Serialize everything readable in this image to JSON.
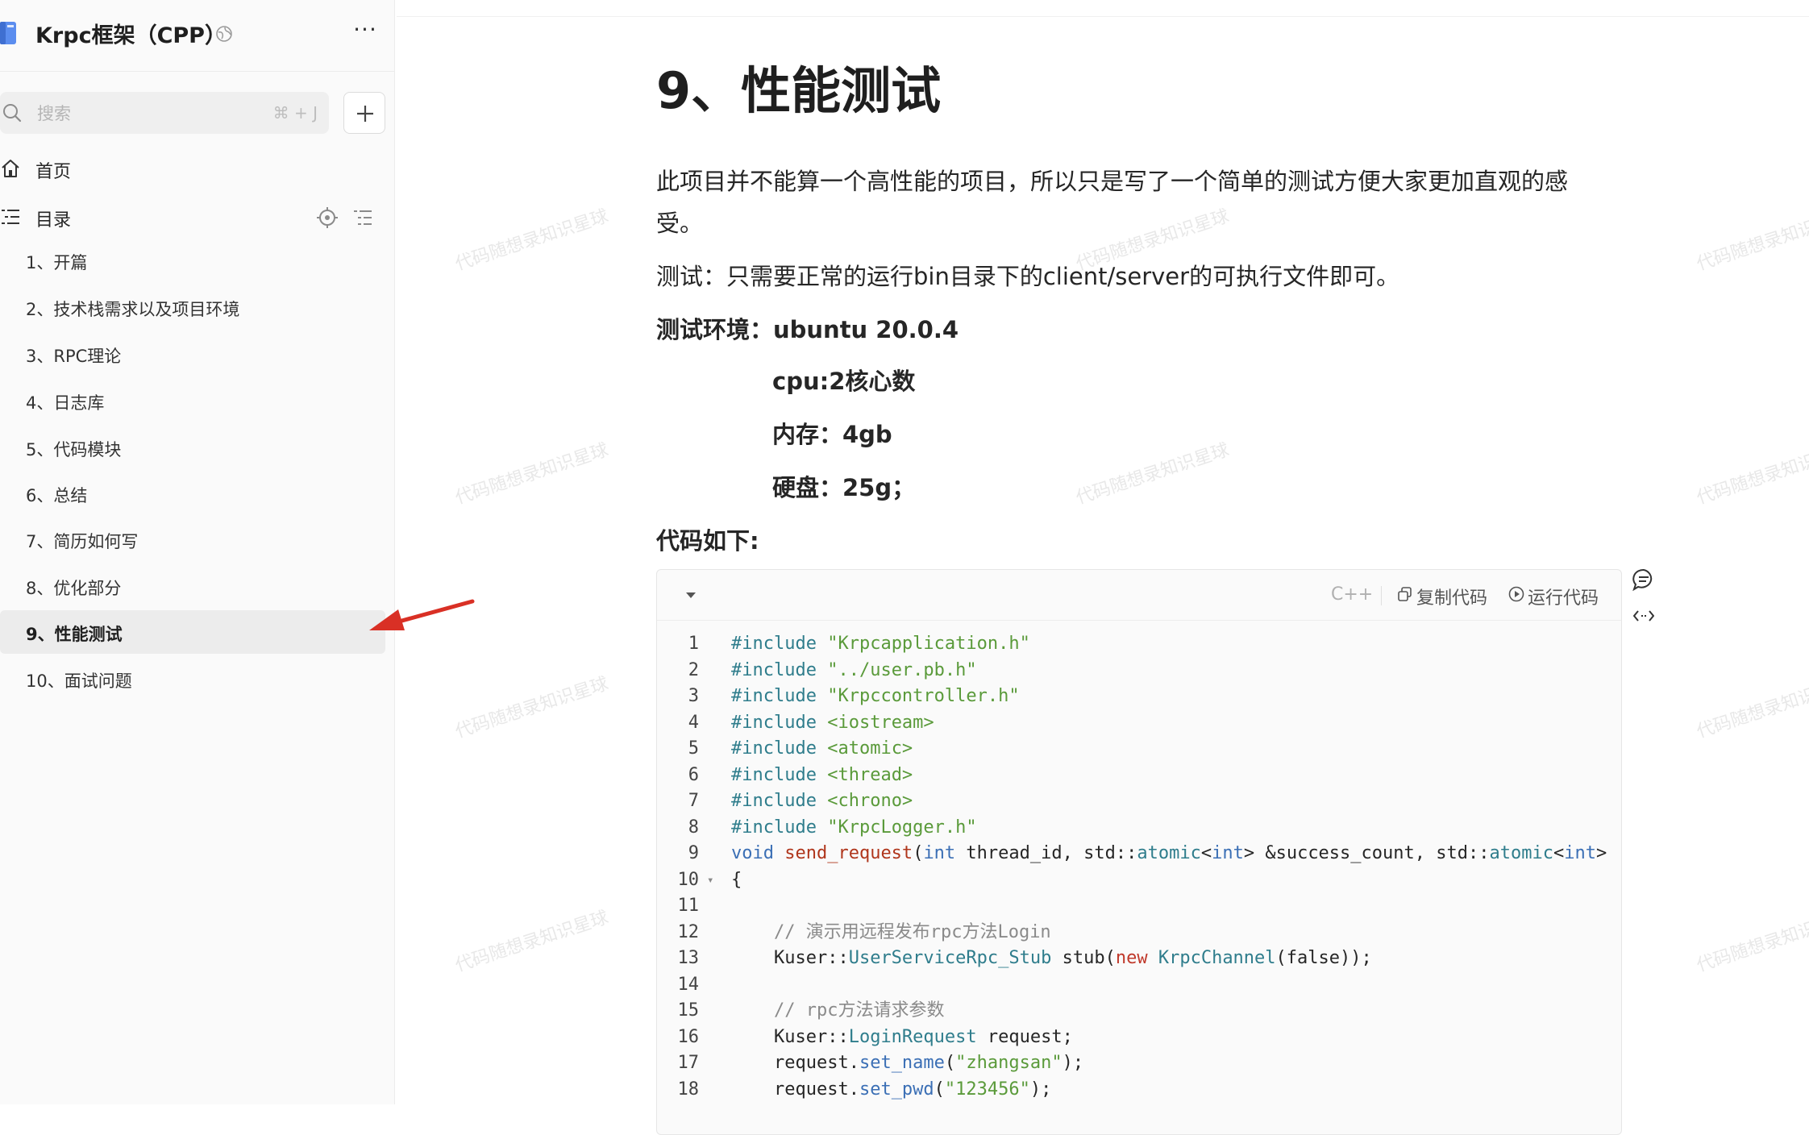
{
  "sidebar": {
    "book_title": "Krpc框架（CPP）",
    "search": {
      "placeholder": "搜索",
      "shortcut": "⌘ + J"
    },
    "nav": {
      "home": "首页",
      "toc": "目录"
    },
    "toc_items": [
      "1、开篇",
      "2、技术栈需求以及项目环境",
      "3、RPC理论",
      "4、日志库",
      "5、代码模块",
      "6、总结",
      "7、简历如何写",
      "8、优化部分",
      "9、性能测试",
      "10、面试问题"
    ],
    "active_index": 8
  },
  "doc": {
    "title": "9、性能测试",
    "para1_line1": "此项目并不能算一个高性能的项目，所以只是写了一个简单的测试方便大家更加直观的感",
    "para1_line2": "受。",
    "para2": "测试：只需要正常的运行bin目录下的client/server的可执行文件即可。",
    "env_line": "测试环境：ubuntu 20.0.4",
    "cpu_line": "cpu:2核心数",
    "mem_line": "内存：4gb",
    "disk_line": "硬盘：25g；",
    "code_heading": "代码如下:"
  },
  "code_block": {
    "language": "C++",
    "copy_label": "复制代码",
    "run_label": "运行代码",
    "lines": [
      {
        "n": "1",
        "fold": false,
        "tokens": [
          [
            "pre",
            "#include "
          ],
          [
            "str",
            "\"Krpcapplication.h\""
          ]
        ]
      },
      {
        "n": "2",
        "fold": false,
        "tokens": [
          [
            "pre",
            "#include "
          ],
          [
            "str",
            "\"../user.pb.h\""
          ]
        ]
      },
      {
        "n": "3",
        "fold": false,
        "tokens": [
          [
            "pre",
            "#include "
          ],
          [
            "str",
            "\"Krpccontroller.h\""
          ]
        ]
      },
      {
        "n": "4",
        "fold": false,
        "tokens": [
          [
            "pre",
            "#include "
          ],
          [
            "str",
            "<iostream>"
          ]
        ]
      },
      {
        "n": "5",
        "fold": false,
        "tokens": [
          [
            "pre",
            "#include "
          ],
          [
            "str",
            "<atomic>"
          ]
        ]
      },
      {
        "n": "6",
        "fold": false,
        "tokens": [
          [
            "pre",
            "#include "
          ],
          [
            "str",
            "<thread>"
          ]
        ]
      },
      {
        "n": "7",
        "fold": false,
        "tokens": [
          [
            "pre",
            "#include "
          ],
          [
            "str",
            "<chrono>"
          ]
        ]
      },
      {
        "n": "8",
        "fold": false,
        "tokens": [
          [
            "pre",
            "#include "
          ],
          [
            "str",
            "\"KrpcLogger.h\""
          ]
        ]
      },
      {
        "n": "9",
        "fold": false,
        "tokens": [
          [
            "kw",
            "void "
          ],
          [
            "fn",
            "send_request"
          ],
          [
            "p",
            "("
          ],
          [
            "kw",
            "int"
          ],
          [
            "p",
            " thread_id, std::"
          ],
          [
            "ty",
            "atomic"
          ],
          [
            "p",
            "<"
          ],
          [
            "kw",
            "int"
          ],
          [
            "p",
            "> &success_count, std::"
          ],
          [
            "ty",
            "atomic"
          ],
          [
            "p",
            "<"
          ],
          [
            "kw",
            "int"
          ],
          [
            "p",
            ">"
          ]
        ]
      },
      {
        "n": "10",
        "fold": true,
        "tokens": [
          [
            "p",
            "{"
          ]
        ]
      },
      {
        "n": "11",
        "fold": false,
        "tokens": []
      },
      {
        "n": "12",
        "fold": false,
        "tokens": [
          [
            "p",
            "    "
          ],
          [
            "cm",
            "// 演示用远程发布rpc方法Login"
          ]
        ]
      },
      {
        "n": "13",
        "fold": false,
        "tokens": [
          [
            "p",
            "    Kuser::"
          ],
          [
            "ty",
            "UserServiceRpc_Stub"
          ],
          [
            "p",
            " stub("
          ],
          [
            "new",
            "new "
          ],
          [
            "ty",
            "KrpcChannel"
          ],
          [
            "p",
            "(false));"
          ]
        ]
      },
      {
        "n": "14",
        "fold": false,
        "tokens": []
      },
      {
        "n": "15",
        "fold": false,
        "tokens": [
          [
            "p",
            "    "
          ],
          [
            "cm",
            "// rpc方法请求参数"
          ]
        ]
      },
      {
        "n": "16",
        "fold": false,
        "tokens": [
          [
            "p",
            "    Kuser::"
          ],
          [
            "ty",
            "LoginRequest"
          ],
          [
            "p",
            " request;"
          ]
        ]
      },
      {
        "n": "17",
        "fold": false,
        "tokens": [
          [
            "p",
            "    request."
          ],
          [
            "kw",
            "set_name"
          ],
          [
            "p",
            "("
          ],
          [
            "str",
            "\"zhangsan\""
          ],
          [
            "p",
            ");"
          ]
        ]
      },
      {
        "n": "18",
        "fold": false,
        "tokens": [
          [
            "p",
            "    request."
          ],
          [
            "kw",
            "set_pwd"
          ],
          [
            "p",
            "("
          ],
          [
            "str",
            "\"123456\""
          ],
          [
            "p",
            ");"
          ]
        ]
      }
    ]
  },
  "watermark_text": "代码随想录知识星球",
  "colors": {
    "accent_red": "#d93025",
    "active_bg": "#ececec",
    "sidebar_bg": "#fafafa"
  }
}
